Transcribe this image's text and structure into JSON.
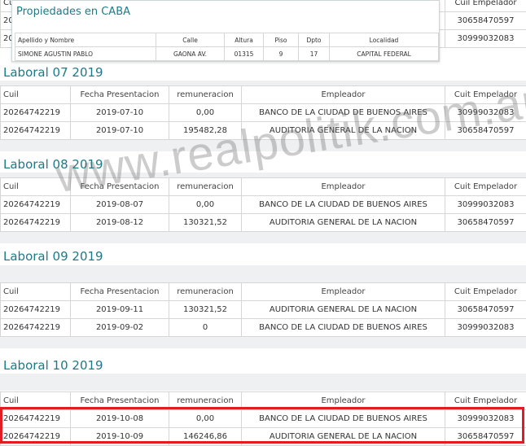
{
  "top": {
    "header_col": "Cuil Empelador",
    "partial_left": [
      "Cui",
      "20",
      "20"
    ],
    "right_vals": [
      "30658470597",
      "30999032083"
    ]
  },
  "popup": {
    "title": "Propiedades en CABA",
    "headers": [
      "Apellido y Nombre",
      "Calle",
      "Altura",
      "Piso",
      "Dpto",
      "Localidad"
    ],
    "row": [
      "SIMONE AGUSTIN PABLO",
      "GAONA AV.",
      "01315",
      "9",
      "17",
      "CAPITAL FEDERAL"
    ]
  },
  "headers": [
    "Cuil",
    "Fecha Presentacion",
    "remuneracion",
    "Empleador",
    "Cuit Empelador"
  ],
  "sections": [
    {
      "title": "Laboral 07 2019",
      "rows": [
        [
          "20264742219",
          "2019-07-10",
          "0,00",
          "BANCO DE LA CIUDAD DE BUENOS AIRES",
          "30999032083"
        ],
        [
          "20264742219",
          "2019-07-10",
          "195482,28",
          "AUDITORIA GENERAL DE LA NACION",
          "30658470597"
        ]
      ]
    },
    {
      "title": "Laboral 08 2019",
      "rows": [
        [
          "20264742219",
          "2019-08-07",
          "0,00",
          "BANCO DE LA CIUDAD DE BUENOS AIRES",
          "30999032083"
        ],
        [
          "20264742219",
          "2019-08-12",
          "130321,52",
          "AUDITORIA GENERAL DE LA NACION",
          "30658470597"
        ]
      ]
    },
    {
      "title": "Laboral 09 2019",
      "rows": [
        [
          "20264742219",
          "2019-09-11",
          "130321,52",
          "AUDITORIA GENERAL DE LA NACION",
          "30658470597"
        ],
        [
          "20264742219",
          "2019-09-02",
          "0",
          "BANCO DE LA CIUDAD DE BUENOS AIRES",
          "30999032083"
        ]
      ]
    },
    {
      "title": "Laboral 10 2019",
      "rows": [
        [
          "20264742219",
          "2019-10-08",
          "0,00",
          "BANCO DE LA CIUDAD DE BUENOS AIRES",
          "30999032083"
        ],
        [
          "20264742219",
          "2019-10-09",
          "146246,86",
          "AUDITORIA GENERAL DE LA NACION",
          "30658470597"
        ]
      ]
    }
  ],
  "watermark": "www.realpolitik.com.ar",
  "colors": {
    "accent": "#1e7a86",
    "highlight": "#e31b23",
    "band": "#eef0f1"
  }
}
